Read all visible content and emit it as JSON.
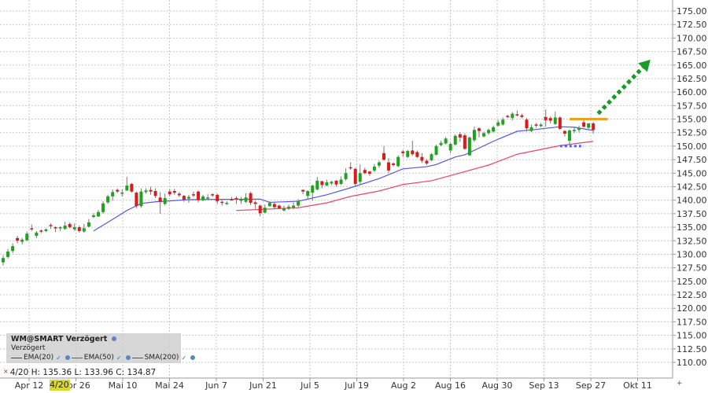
{
  "chart_data": {
    "type": "candlestick",
    "y_axis": {
      "min": 110,
      "max": 175,
      "step": 2.5,
      "position": "right",
      "tick_labels": [
        "175.00",
        "172.50",
        "170.00",
        "167.50",
        "165.00",
        "162.50",
        "160.00",
        "157.50",
        "155.00",
        "152.50",
        "150.00",
        "147.50",
        "145.00",
        "142.50",
        "140.00",
        "137.50",
        "135.00",
        "132.50",
        "130.00",
        "127.50",
        "125.00",
        "122.50",
        "120.00",
        "117.50",
        "115.00",
        "112.50",
        "110.00"
      ]
    },
    "x_axis": {
      "tick_labels": [
        "Apr 12",
        "Apr 26",
        "Mai 10",
        "Mai 24",
        "Jun 7",
        "Jun 21",
        "Jul 5",
        "Jul 19",
        "Aug 2",
        "Aug 16",
        "Aug 30",
        "Sep 13",
        "Sep 27",
        "Okt 11"
      ]
    },
    "grid": true,
    "colors": {
      "up": "#1fa31f",
      "down": "#dd1a1a",
      "wick": "#777777",
      "ema20": "#5555ee",
      "ema50": "#ee4466",
      "resistance": "#f0a020",
      "support": "#4466ee",
      "arrow": "#1a9a2a"
    },
    "candles_ohlc": [
      [
        128.5,
        129.8,
        127.9,
        129.3
      ],
      [
        129.5,
        131.0,
        129.2,
        130.5
      ],
      [
        130.6,
        132.0,
        130.2,
        131.5
      ],
      [
        133.0,
        133.4,
        132.0,
        132.5
      ],
      [
        132.3,
        133.0,
        131.8,
        132.7
      ],
      [
        132.6,
        134.2,
        132.4,
        133.8
      ],
      [
        134.8,
        135.5,
        134.3,
        134.6
      ],
      [
        133.4,
        134.3,
        133.0,
        134.0
      ],
      [
        134.4,
        134.6,
        133.9,
        134.2
      ],
      [
        134.3,
        134.8,
        134.1,
        134.6
      ],
      [
        135.4,
        135.7,
        134.7,
        135.2
      ],
      [
        135.0,
        135.2,
        134.1,
        134.8
      ],
      [
        134.8,
        135.2,
        134.3,
        135.0
      ],
      [
        134.7,
        136.0,
        134.5,
        135.3
      ],
      [
        135.6,
        135.9,
        134.8,
        135.0
      ],
      [
        134.6,
        135.7,
        134.3,
        135.0
      ],
      [
        135.0,
        135.3,
        134.0,
        134.3
      ],
      [
        134.2,
        135.6,
        134.0,
        134.8
      ],
      [
        135.1,
        136.5,
        135.0,
        135.9
      ],
      [
        136.9,
        137.6,
        136.7,
        137.2
      ],
      [
        137.0,
        138.2,
        136.9,
        137.8
      ],
      [
        137.8,
        139.8,
        137.5,
        139.4
      ],
      [
        139.6,
        141.0,
        139.3,
        140.7
      ],
      [
        140.7,
        142.0,
        139.9,
        141.5
      ],
      [
        141.9,
        142.2,
        141.3,
        141.6
      ],
      [
        141.3,
        142.0,
        140.7,
        141.4
      ],
      [
        141.8,
        144.3,
        141.7,
        142.7
      ],
      [
        143.0,
        143.2,
        141.4,
        141.6
      ],
      [
        141.4,
        141.6,
        138.5,
        138.9
      ],
      [
        138.9,
        142.2,
        138.6,
        141.6
      ],
      [
        141.5,
        142.2,
        141.2,
        141.8
      ],
      [
        141.9,
        142.5,
        141.0,
        141.6
      ],
      [
        141.7,
        142.2,
        140.4,
        140.8
      ],
      [
        140.5,
        141.5,
        137.5,
        139.7
      ],
      [
        139.3,
        141.2,
        139.0,
        140.4
      ],
      [
        141.6,
        142.0,
        140.7,
        141.1
      ],
      [
        141.7,
        142.1,
        141.0,
        141.4
      ],
      [
        141.2,
        141.5,
        140.6,
        140.9
      ],
      [
        140.8,
        141.0,
        139.7,
        140.1
      ],
      [
        140.3,
        141.0,
        139.5,
        140.6
      ],
      [
        141.1,
        141.6,
        140.6,
        141.0
      ],
      [
        141.6,
        141.8,
        139.6,
        140.0
      ],
      [
        140.0,
        141.0,
        139.8,
        140.7
      ],
      [
        140.3,
        141.1,
        140.0,
        140.5
      ],
      [
        141.1,
        141.3,
        140.6,
        141.0
      ],
      [
        141.0,
        141.2,
        139.3,
        139.8
      ],
      [
        139.7,
        140.0,
        139.0,
        139.5
      ],
      [
        139.3,
        139.8,
        139.1,
        139.5
      ],
      [
        140.2,
        140.6,
        139.9,
        140.1
      ],
      [
        140.4,
        140.7,
        139.3,
        140.3
      ],
      [
        140.0,
        140.6,
        139.3,
        140.1
      ],
      [
        139.7,
        141.3,
        139.5,
        140.5
      ],
      [
        141.3,
        141.6,
        139.1,
        139.5
      ],
      [
        139.6,
        139.9,
        138.4,
        139.3
      ],
      [
        139.0,
        139.2,
        137.0,
        137.6
      ],
      [
        137.7,
        139.2,
        137.6,
        138.6
      ],
      [
        138.9,
        139.8,
        138.8,
        139.5
      ],
      [
        139.3,
        139.6,
        138.3,
        138.7
      ],
      [
        139.0,
        139.2,
        138.3,
        138.5
      ],
      [
        138.1,
        139.0,
        137.9,
        138.5
      ],
      [
        138.4,
        139.2,
        138.2,
        138.8
      ],
      [
        138.6,
        139.6,
        138.3,
        139.0
      ],
      [
        139.0,
        140.2,
        138.7,
        139.8
      ],
      [
        141.9,
        142.0,
        141.1,
        141.6
      ],
      [
        140.8,
        141.8,
        140.2,
        141.7
      ],
      [
        141.4,
        142.9,
        139.9,
        142.7
      ],
      [
        142.0,
        144.3,
        141.8,
        143.6
      ],
      [
        143.5,
        143.6,
        142.2,
        142.8
      ],
      [
        142.7,
        143.8,
        142.6,
        143.3
      ],
      [
        143.1,
        143.6,
        142.8,
        143.4
      ],
      [
        143.6,
        143.7,
        142.5,
        142.9
      ],
      [
        143.0,
        144.4,
        142.8,
        143.8
      ],
      [
        143.9,
        145.9,
        143.6,
        145.0
      ],
      [
        146.1,
        147.0,
        145.6,
        145.9
      ],
      [
        145.8,
        146.0,
        142.5,
        143.0
      ],
      [
        143.4,
        146.6,
        143.0,
        145.0
      ],
      [
        145.6,
        146.0,
        144.8,
        145.0
      ],
      [
        145.3,
        145.4,
        144.5,
        144.9
      ],
      [
        145.5,
        146.7,
        145.2,
        146.2
      ],
      [
        146.4,
        147.3,
        146.0,
        147.0
      ],
      [
        148.7,
        150.0,
        147.3,
        147.5
      ],
      [
        147.0,
        147.8,
        145.0,
        145.5
      ],
      [
        146.8,
        147.0,
        146.2,
        146.5
      ],
      [
        146.3,
        148.3,
        146.1,
        148.0
      ],
      [
        149.0,
        149.3,
        148.0,
        148.7
      ],
      [
        148.0,
        149.3,
        147.8,
        149.1
      ],
      [
        149.2,
        151.0,
        148.2,
        148.5
      ],
      [
        148.9,
        149.2,
        147.8,
        148.0
      ],
      [
        148.0,
        148.7,
        146.9,
        147.3
      ],
      [
        147.3,
        147.6,
        146.5,
        146.8
      ],
      [
        147.4,
        148.7,
        147.2,
        148.5
      ],
      [
        148.4,
        150.3,
        148.3,
        150.0
      ],
      [
        150.2,
        151.0,
        150.0,
        150.6
      ],
      [
        150.5,
        151.7,
        150.3,
        151.4
      ],
      [
        149.2,
        150.6,
        148.7,
        150.4
      ],
      [
        150.3,
        152.2,
        150.1,
        151.9
      ],
      [
        152.2,
        152.6,
        150.8,
        151.6
      ],
      [
        152.0,
        152.4,
        149.3,
        149.5
      ],
      [
        148.3,
        151.8,
        148.2,
        151.6
      ],
      [
        151.1,
        153.6,
        150.8,
        153.0
      ],
      [
        153.3,
        153.5,
        151.6,
        152.8
      ],
      [
        151.8,
        152.7,
        151.6,
        152.4
      ],
      [
        152.4,
        153.2,
        152.1,
        153.0
      ],
      [
        152.7,
        153.8,
        152.5,
        153.5
      ],
      [
        153.8,
        154.8,
        153.6,
        154.4
      ],
      [
        154.0,
        155.3,
        153.8,
        154.9
      ],
      [
        155.6,
        155.8,
        155.2,
        155.4
      ],
      [
        155.2,
        156.3,
        154.8,
        156.0
      ],
      [
        155.9,
        156.6,
        155.5,
        155.8
      ],
      [
        155.7,
        156.0,
        155.2,
        155.4
      ],
      [
        154.9,
        155.2,
        152.7,
        153.3
      ],
      [
        152.8,
        154.0,
        152.6,
        153.5
      ],
      [
        154.0,
        154.3,
        153.4,
        153.8
      ],
      [
        153.7,
        154.3,
        153.5,
        154.0
      ],
      [
        155.4,
        156.8,
        153.6,
        154.8
      ],
      [
        155.2,
        155.5,
        154.2,
        154.7
      ],
      [
        154.1,
        156.4,
        153.9,
        155.3
      ],
      [
        155.3,
        155.5,
        153.0,
        153.2
      ],
      [
        152.8,
        153.0,
        151.8,
        152.3
      ],
      [
        151.0,
        153.1,
        150.3,
        152.9
      ],
      [
        152.8,
        153.6,
        152.4,
        153.0
      ],
      [
        153.0,
        153.8,
        152.5,
        153.4
      ],
      [
        154.4,
        154.8,
        153.4,
        153.6
      ],
      [
        153.4,
        154.3,
        153.2,
        154.2
      ],
      [
        154.2,
        154.5,
        152.3,
        153.0
      ]
    ],
    "series": [
      {
        "name": "EMA(20)",
        "points": [
          [
            19,
            134.3
          ],
          [
            24,
            137.0
          ],
          [
            26,
            138.1
          ],
          [
            29,
            139.4
          ],
          [
            32,
            139.7
          ],
          [
            39,
            140.1
          ],
          [
            54,
            140.2
          ],
          [
            56,
            139.6
          ],
          [
            62,
            139.8
          ],
          [
            68,
            141.0
          ],
          [
            73,
            142.3
          ],
          [
            79,
            144.0
          ],
          [
            84,
            145.8
          ],
          [
            89,
            146.2
          ],
          [
            91,
            146.6
          ],
          [
            95,
            148.0
          ],
          [
            97,
            148.4
          ],
          [
            103,
            150.9
          ],
          [
            108,
            152.75
          ],
          [
            111,
            153.0
          ],
          [
            117,
            153.6
          ],
          [
            120,
            153.5
          ],
          [
            124,
            152.9
          ]
        ]
      },
      {
        "name": "EMA(50)",
        "points": [
          [
            49,
            138.1
          ],
          [
            62,
            138.6
          ],
          [
            68,
            139.5
          ],
          [
            73,
            140.7
          ],
          [
            79,
            141.7
          ],
          [
            84,
            142.9
          ],
          [
            90,
            143.6
          ],
          [
            95,
            144.8
          ],
          [
            102,
            146.5
          ],
          [
            108,
            148.5
          ],
          [
            117,
            150.1
          ],
          [
            124,
            150.9
          ]
        ]
      },
      {
        "name": "SMA(200)",
        "points": []
      }
    ],
    "annotations": {
      "resistance_line": {
        "value": 155.0,
        "from": 119,
        "to": 127
      },
      "support_line": {
        "value": 150.0,
        "from": 117,
        "to": 122
      },
      "trend_arrow": {
        "from": [
          125,
          156.0
        ],
        "to": [
          136,
          166.0
        ]
      }
    }
  },
  "legend": {
    "title": "WM@SMART Verzögert",
    "subtitle": "Verzögert",
    "items": [
      {
        "label": "EMA(20)",
        "color": "#3333ee"
      },
      {
        "label": "EMA(50)",
        "color": "#ee2244"
      },
      {
        "label": "SMA(200)",
        "color": "#555555"
      }
    ],
    "check": "✓"
  },
  "status": {
    "close_icon": "×",
    "text": "4/20  H: 135.36  L: 133.96  C: 134.87"
  },
  "crosshair_date": "4/20",
  "corner_plus": "+"
}
